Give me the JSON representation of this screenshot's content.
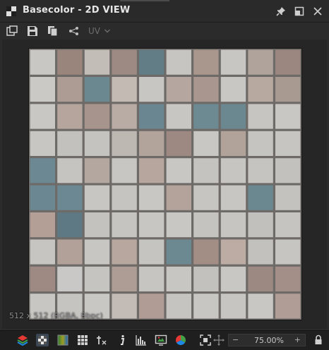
{
  "window": {
    "title": "Basecolor - 2D VIEW"
  },
  "toolbar": {
    "uv_label": "UV"
  },
  "viewport": {
    "resolution_label": "512 x 512 (RGBA, 8bpc)"
  },
  "bottom": {
    "zoom_value": "75.00%",
    "zoom_minus": "−",
    "zoom_plus": "+"
  },
  "tiles": {
    "grid": 10,
    "rows": [
      [
        "#c9c7c4",
        "#9a857d",
        "#c3bdb8",
        "#9d8a83",
        "#637d86",
        "#c7c5c2",
        "#a9978e",
        "#c8c6c3",
        "#b0a39c",
        "#9c8780"
      ],
      [
        "#cbc9c6",
        "#ad9c93",
        "#6b8790",
        "#c3bbb3",
        "#c8c6c3",
        "#b5a6a0",
        "#a8968f",
        "#c9c7c4",
        "#b8a9a0",
        "#a89a91"
      ],
      [
        "#c9c7c4",
        "#b5a59d",
        "#a7948d",
        "#b8aca4",
        "#6a8690",
        "#c8c6c3",
        "#6d8992",
        "#6b8891",
        "#c7c5c2",
        "#c9c7c4"
      ],
      [
        "#c8c6c3",
        "#c3c1be",
        "#c5c3c0",
        "#bdb8b2",
        "#b3a49b",
        "#9e8982",
        "#c9c7c4",
        "#b1a29a",
        "#c6c4c1",
        "#c7c5c2"
      ],
      [
        "#6c8893",
        "#c6c4c1",
        "#b4a79f",
        "#c8c6c3",
        "#b7a69d",
        "#c9c7c4",
        "#c5c3c0",
        "#c7c5c2",
        "#c6c4c1",
        "#c3c1be"
      ],
      [
        "#6b8792",
        "#6c8892",
        "#c8c6c3",
        "#c6c4c1",
        "#c9c7c4",
        "#b3a39b",
        "#c7c5c2",
        "#c8c6c3",
        "#6b8891",
        "#c4c2bf"
      ],
      [
        "#b49f96",
        "#5f7984",
        "#c4c2bf",
        "#c6c4c1",
        "#c8c6c3",
        "#c9c7c4",
        "#c5c3c0",
        "#c7c5c2",
        "#c2c0bd",
        "#c6c4c1"
      ],
      [
        "#c7c5c2",
        "#b2a198",
        "#c8c6c3",
        "#b8a79f",
        "#c6c4c1",
        "#6c8992",
        "#a38e86",
        "#bcaca4",
        "#c3c1be",
        "#c7c5c2"
      ],
      [
        "#9e8a83",
        "#c9c8c6",
        "#c6c4c1",
        "#ad9d95",
        "#c7c5c2",
        "#c8c6c3",
        "#c3c1be",
        "#c9c7c4",
        "#9c8982",
        "#a38f88"
      ],
      [
        "#c8c6c3",
        "#c6c4c1",
        "#c9c7c4",
        "#c3bcb6",
        "#b09c94",
        "#c6c4c1",
        "#c8c6c3",
        "#c7c5c2",
        "#c9c7c4",
        "#b09d95"
      ]
    ]
  }
}
